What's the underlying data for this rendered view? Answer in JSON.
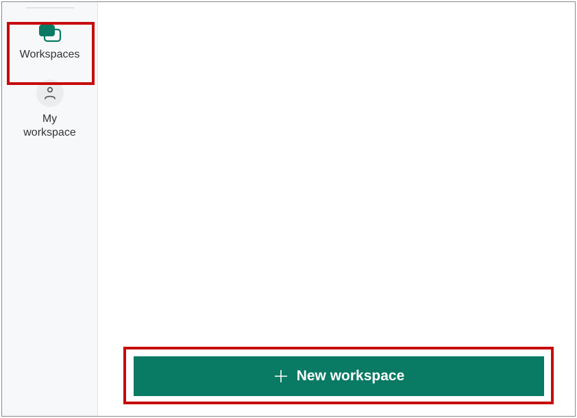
{
  "sidebar": {
    "workspaces": {
      "label": "Workspaces",
      "icon_name": "workspaces-stack-icon"
    },
    "my_workspace": {
      "label": "My\nworkspace",
      "icon_name": "person-circle-icon"
    }
  },
  "main": {
    "new_workspace_button": {
      "label": "New workspace",
      "icon_name": "plus-icon"
    }
  },
  "colors": {
    "accent": "#097a63",
    "highlight": "#c60a0a",
    "sidebar_bg": "#f7f8f9",
    "icon_circle_bg": "#ebecee"
  }
}
